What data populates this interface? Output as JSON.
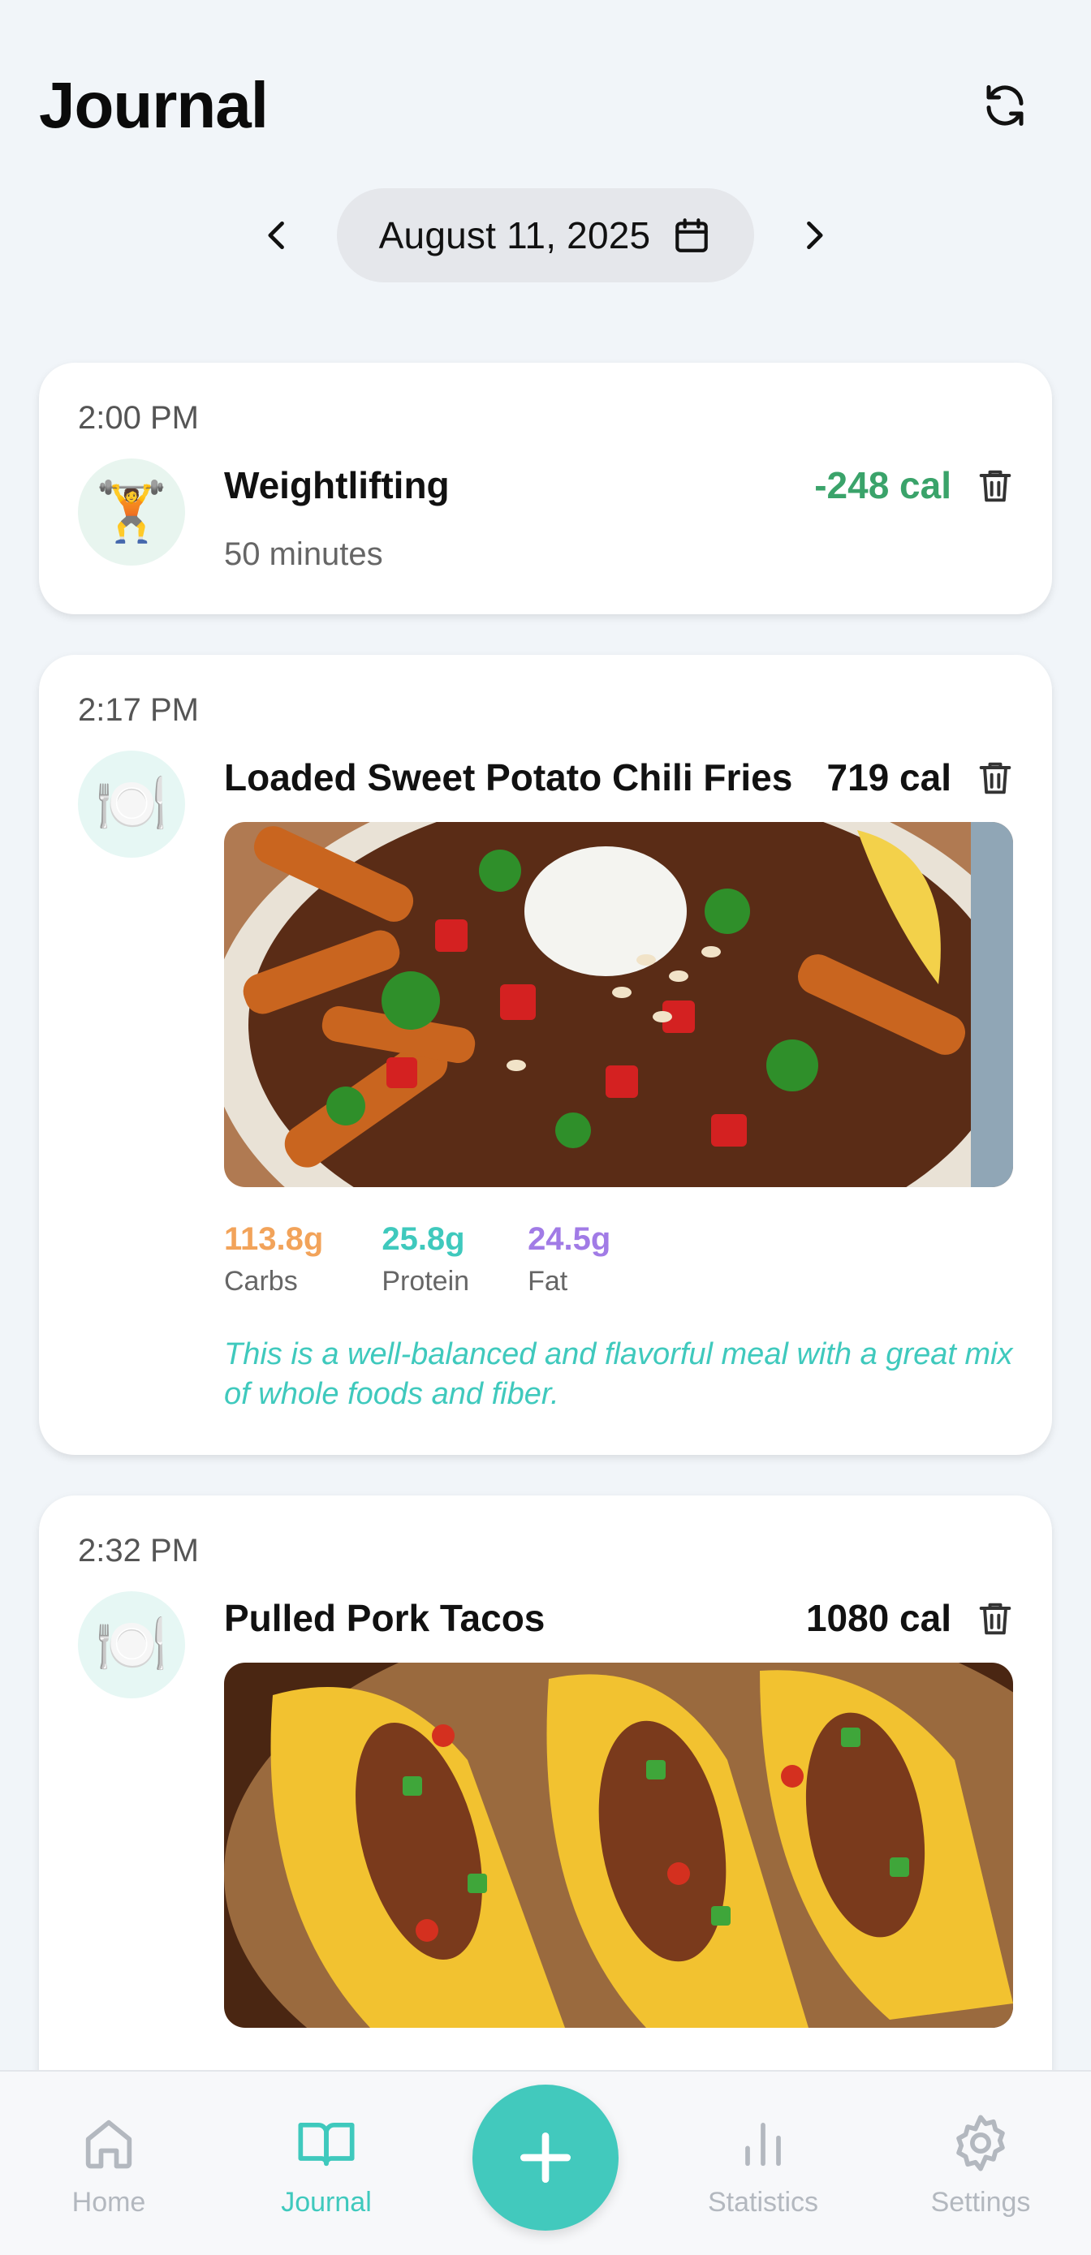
{
  "header": {
    "title": "Journal"
  },
  "date_nav": {
    "date": "August 11, 2025"
  },
  "entries": [
    {
      "time": "2:00 PM",
      "name": "Weightlifting",
      "calories": "-248 cal",
      "detail": "50 minutes",
      "icon": "weightlifter-emoji"
    },
    {
      "time": "2:17 PM",
      "name": "Loaded Sweet Potato Chili Fries",
      "calories": "719 cal",
      "icon": "plate-cutlery-emoji",
      "macros": {
        "carbs": "113.8g",
        "carbs_label": "Carbs",
        "protein": "25.8g",
        "protein_label": "Protein",
        "fat": "24.5g",
        "fat_label": "Fat"
      },
      "note": "This is a well-balanced and flavorful meal with a great mix of whole foods and fiber."
    },
    {
      "time": "2:32 PM",
      "name": "Pulled Pork Tacos",
      "calories": "1080 cal",
      "icon": "plate-cutlery-emoji"
    }
  ],
  "bottom_nav": {
    "items": [
      {
        "label": "Home"
      },
      {
        "label": "Journal"
      },
      {
        "label": "Statistics"
      },
      {
        "label": "Settings"
      }
    ]
  },
  "colors": {
    "accent": "#42c9bd",
    "burn": "#3aa36a",
    "carbs": "#f2a35a",
    "protein": "#3fc9bd",
    "fat": "#a17be6"
  }
}
